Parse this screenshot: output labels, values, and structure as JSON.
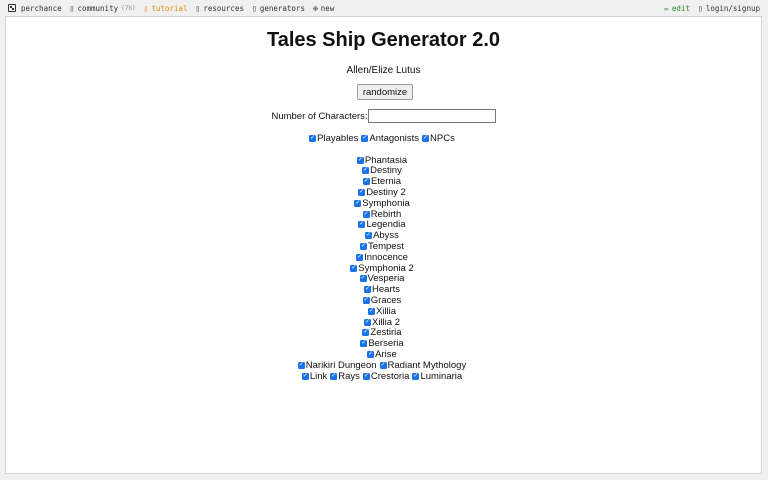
{
  "topbar": {
    "brand": "perchance",
    "community": "community",
    "community_count": "(7h)",
    "tutorial": "tutorial",
    "resources": "resources",
    "generators": "generators",
    "new": "new",
    "edit": "edit",
    "login": "login/signup",
    "colors": {
      "tutorial": "#e08a1e",
      "edit": "#2e8b2e"
    }
  },
  "main": {
    "title": "Tales Ship Generator 2.0",
    "result": "Allen/Elize Lutus",
    "randomize_label": "randomize",
    "count_label": "Number of Characters:",
    "count_value": ""
  },
  "categories": [
    {
      "label": "Playables",
      "checked": true
    },
    {
      "label": "Antagonists",
      "checked": true
    },
    {
      "label": "NPCs",
      "checked": true
    }
  ],
  "games_rows": [
    [
      "Phantasia"
    ],
    [
      "Destiny"
    ],
    [
      "Eternia"
    ],
    [
      "Destiny 2"
    ],
    [
      "Symphonia"
    ],
    [
      "Rebirth"
    ],
    [
      "Legendia"
    ],
    [
      "Abyss"
    ],
    [
      "Tempest"
    ],
    [
      "Innocence"
    ],
    [
      "Symphonia 2"
    ],
    [
      "Vesperia"
    ],
    [
      "Hearts"
    ],
    [
      "Graces"
    ],
    [
      "Xillia"
    ],
    [
      "Xillia 2"
    ],
    [
      "Zestiria"
    ],
    [
      "Berseria"
    ],
    [
      "Arise"
    ],
    [
      "Narikiri Dungeon",
      "Radiant Mythology"
    ],
    [
      "Link",
      "Rays",
      "Crestoria",
      "Luminaria"
    ]
  ],
  "checkbox_color": "#1a73e8"
}
